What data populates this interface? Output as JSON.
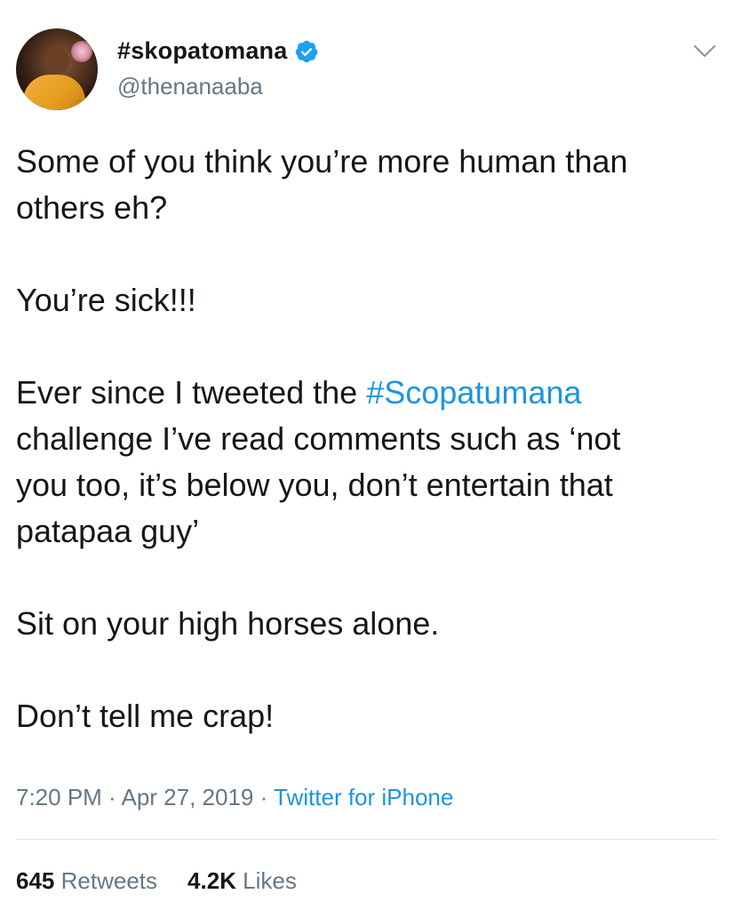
{
  "author": {
    "display_name": "#skopatomana",
    "handle": "@thenanaaba",
    "verified": true,
    "avatar_icon": "profile-photo"
  },
  "tweet": {
    "paragraphs": [
      [
        "Some of you think you’re more human than",
        "others eh?"
      ],
      [
        "You’re sick!!!"
      ],
      [
        "Ever since I tweeted the ",
        "#Scopatumana",
        "challenge I’ve read comments such as ‘not",
        "you too, it’s below you, don’t entertain that",
        "patapaa guy’"
      ],
      [
        "Sit on your high horses alone."
      ],
      [
        "Don’t tell me crap!"
      ]
    ],
    "line1": "Some of you think you’re more human than",
    "line2": "others eh?",
    "line3": "You’re sick!!!",
    "line4_prefix": "Ever since I tweeted the ",
    "line4_hashtag": "#Scopatumana",
    "line5": "challenge I’ve read comments such as ‘not",
    "line6": "you too, it’s below you, don’t entertain that",
    "line7": "patapaa guy’",
    "line8": "Sit on your high horses alone.",
    "line9": "Don’t tell me crap!"
  },
  "meta": {
    "time": "7:20 PM",
    "separator": " · ",
    "date": "Apr 27, 2019",
    "source": "Twitter for iPhone"
  },
  "stats": {
    "retweets_count": "645",
    "retweets_label": "Retweets",
    "likes_count": "4.2K",
    "likes_label": "Likes"
  },
  "colors": {
    "link": "#1b95e0",
    "secondary_text": "#657786",
    "primary_text": "#14171a",
    "verified_badge": "#1da1f2"
  },
  "icons": {
    "verified": "verified-badge-icon",
    "menu": "chevron-down-icon"
  }
}
